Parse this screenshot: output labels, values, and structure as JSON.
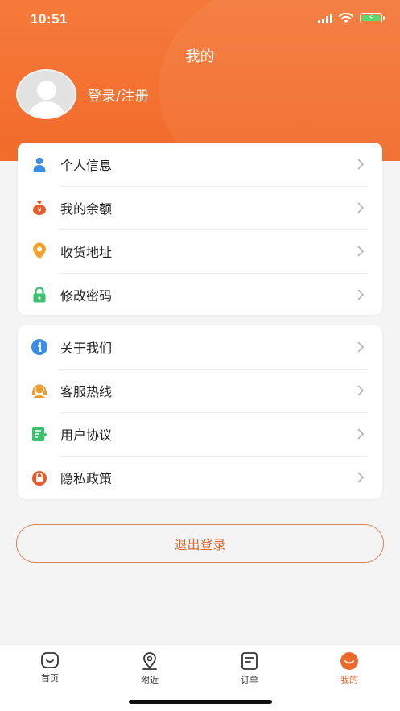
{
  "status_bar": {
    "time": "10:51"
  },
  "header": {
    "title": "我的",
    "login_label": "登录/注册"
  },
  "menu_group_1": [
    {
      "label": "个人信息",
      "icon": "person-icon",
      "color": "#3b8ee8"
    },
    {
      "label": "我的余额",
      "icon": "money-bag-icon",
      "color": "#e85a2a"
    },
    {
      "label": "收货地址",
      "icon": "location-pin-icon",
      "color": "#f2a22c"
    },
    {
      "label": "修改密码",
      "icon": "lock-icon",
      "color": "#3cc26e"
    }
  ],
  "menu_group_2": [
    {
      "label": "关于我们",
      "icon": "info-icon",
      "color": "#3b8ee8"
    },
    {
      "label": "客服热线",
      "icon": "headset-icon",
      "color": "#f29a2c"
    },
    {
      "label": "用户协议",
      "icon": "document-edit-icon",
      "color": "#3cc26e"
    },
    {
      "label": "隐私政策",
      "icon": "privacy-lock-icon",
      "color": "#e85a2a"
    }
  ],
  "logout_label": "退出登录",
  "tabbar": [
    {
      "label": "首页",
      "icon": "home-icon"
    },
    {
      "label": "附近",
      "icon": "nearby-icon"
    },
    {
      "label": "订单",
      "icon": "order-icon"
    },
    {
      "label": "我的",
      "icon": "profile-icon",
      "active": true
    }
  ],
  "colors": {
    "accent": "#f26b2b",
    "active_tab": "#ee6a2c"
  }
}
